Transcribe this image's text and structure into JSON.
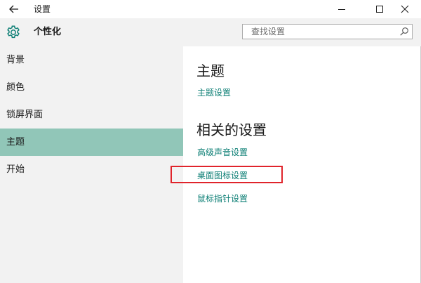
{
  "window": {
    "title": "设置"
  },
  "title_bar": {
    "back_icon": "back-arrow-icon",
    "minimize_icon": "minimize-icon",
    "maximize_icon": "maximize-icon",
    "close_icon": "close-icon"
  },
  "header": {
    "icon": "gear-icon",
    "title": "个性化"
  },
  "search": {
    "placeholder": "查找设置",
    "value": "",
    "icon": "search-icon"
  },
  "sidebar": {
    "items": [
      {
        "label": "背景",
        "selected": false
      },
      {
        "label": "颜色",
        "selected": false
      },
      {
        "label": "锁屏界面",
        "selected": false
      },
      {
        "label": "主题",
        "selected": true
      },
      {
        "label": "开始",
        "selected": false
      }
    ]
  },
  "content": {
    "section_theme": {
      "heading": "主题",
      "links": [
        "主题设置"
      ]
    },
    "section_related": {
      "heading": "相关的设置",
      "links": [
        "高级声音设置",
        "桌面图标设置",
        "鼠标指针设置"
      ]
    },
    "highlighted_link": "桌面图标设置"
  },
  "colors": {
    "accent": "#0b7e74",
    "selected_item": "#91c6b8",
    "annotation_box": "#e0242b",
    "sidebar_bg": "#f2f2f2"
  }
}
